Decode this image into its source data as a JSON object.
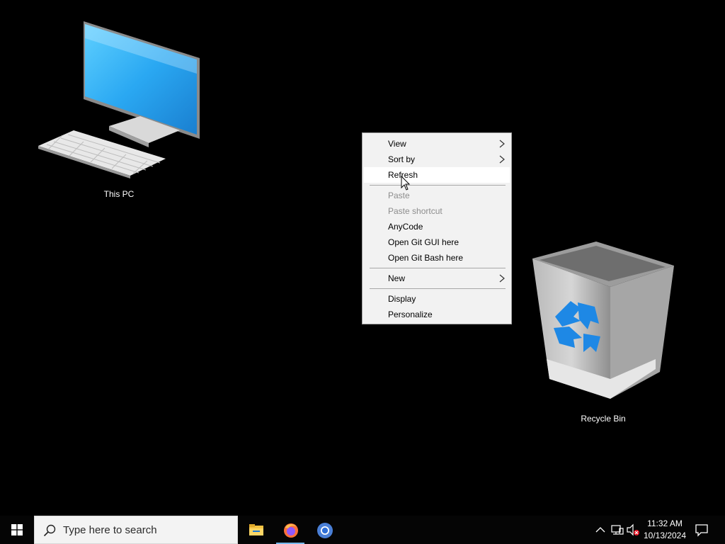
{
  "desktop": {
    "icons": [
      {
        "label": "This PC"
      },
      {
        "label": "Recycle Bin"
      }
    ]
  },
  "context_menu": {
    "items": [
      {
        "label": "View",
        "submenu": true,
        "enabled": true
      },
      {
        "label": "Sort by",
        "submenu": true,
        "enabled": true
      },
      {
        "label": "Refresh",
        "submenu": false,
        "enabled": true,
        "hovered": true
      },
      {
        "label": "Paste",
        "submenu": false,
        "enabled": false
      },
      {
        "label": "Paste shortcut",
        "submenu": false,
        "enabled": false
      },
      {
        "label": "AnyCode",
        "submenu": false,
        "enabled": true
      },
      {
        "label": "Open Git GUI here",
        "submenu": false,
        "enabled": true
      },
      {
        "label": "Open Git Bash here",
        "submenu": false,
        "enabled": true
      },
      {
        "label": "New",
        "submenu": true,
        "enabled": true
      },
      {
        "label": "Display",
        "submenu": false,
        "enabled": true
      },
      {
        "label": "Personalize",
        "submenu": false,
        "enabled": true
      }
    ]
  },
  "taskbar": {
    "search_placeholder": "Type here to search",
    "pinned_apps": [
      {
        "icon": "file-explorer-icon",
        "active": false
      },
      {
        "icon": "firefox-icon",
        "active": true
      },
      {
        "icon": "chromium-icon",
        "active": false
      }
    ],
    "tray": {
      "icons": [
        "chevron-up-icon",
        "network-icon",
        "volume-muted-icon"
      ],
      "time": "11:32 AM",
      "date": "10/13/2024"
    }
  },
  "colors": {
    "desktop_background": "#000000",
    "menu_background": "#f2f2f2",
    "menu_disabled_text": "#8d8d8d",
    "taskbar_background": "#050505",
    "active_indicator": "#76b9ed"
  }
}
